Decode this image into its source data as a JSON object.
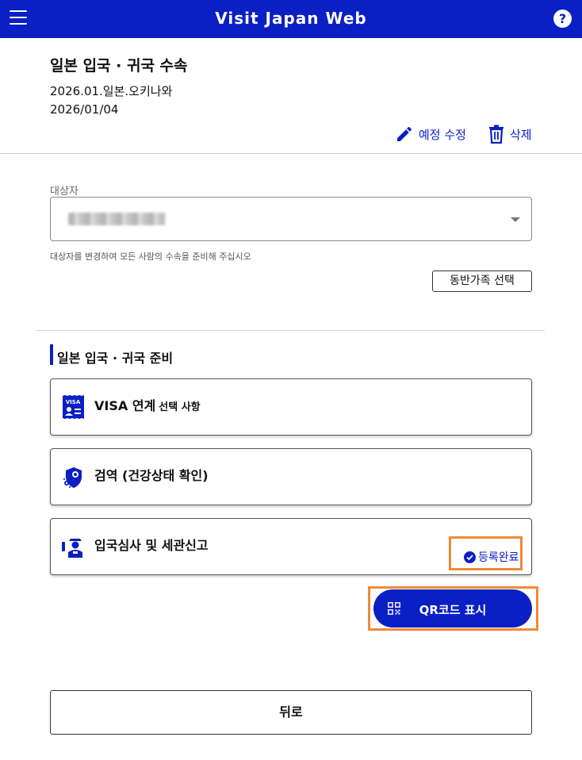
{
  "header": {
    "title": "Visit Japan Web",
    "menu_icon": "hamburger-menu-icon",
    "help_label": "?"
  },
  "plan": {
    "heading": "일본 입국 · 귀국 수속",
    "name": "2026.01.일본.오키나와",
    "date": "2026/01/04",
    "edit_label": "예정 수정",
    "delete_label": "삭제"
  },
  "target": {
    "label": "대상자",
    "help_text": "대상자를 변경하여 모든 사람의 수속을 준비해 주십시오",
    "family_button": "동반가족 선택"
  },
  "section": {
    "title": "일본 입국 · 귀국 준비"
  },
  "cards": [
    {
      "label": "VISA 연계",
      "sub": "선택 사항",
      "icon": "visa-card-icon"
    },
    {
      "label": "검역 (건강상태 확인)",
      "sub": "",
      "icon": "virus-shield-icon"
    },
    {
      "label": "입국심사 및 세관신고",
      "sub": "",
      "icon": "immigration-officer-icon",
      "status": "등록완료"
    }
  ],
  "qr_button": {
    "label": "QR코드 표시"
  },
  "back_button": {
    "label": "뒤로"
  },
  "colors": {
    "brand": "#0a1fc4",
    "highlight": "#f08a34"
  }
}
